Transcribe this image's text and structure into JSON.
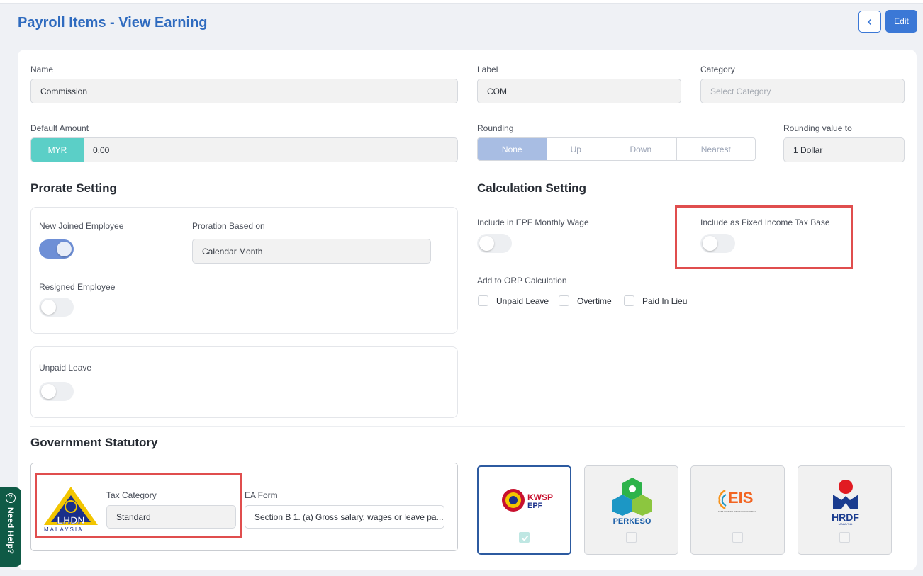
{
  "header": {
    "title": "Payroll Items - View Earning",
    "back_icon": "chevron-left-icon",
    "edit_label": "Edit"
  },
  "form": {
    "name": {
      "label": "Name",
      "value": "Commission"
    },
    "label_field": {
      "label": "Label",
      "value": "COM"
    },
    "category": {
      "label": "Category",
      "placeholder": "Select Category"
    },
    "default_amount": {
      "label": "Default Amount",
      "currency": "MYR",
      "value": "0.00"
    },
    "rounding": {
      "label": "Rounding",
      "options": [
        "None",
        "Up",
        "Down",
        "Nearest"
      ],
      "selected": "None"
    },
    "rounding_value": {
      "label": "Rounding value to",
      "value": "1 Dollar"
    }
  },
  "prorate": {
    "title": "Prorate Setting",
    "new_joined": {
      "label": "New Joined Employee",
      "on": true
    },
    "proration_based": {
      "label": "Proration Based on",
      "value": "Calendar Month"
    },
    "resigned": {
      "label": "Resigned Employee",
      "on": false
    },
    "unpaid_leave": {
      "label": "Unpaid Leave",
      "on": false
    }
  },
  "calculation": {
    "title": "Calculation Setting",
    "epf_monthly_wage": {
      "label": "Include in EPF Monthly Wage",
      "on": false
    },
    "fixed_income_tax": {
      "label": "Include as Fixed Income Tax Base",
      "on": false
    },
    "orp": {
      "label": "Add to ORP Calculation",
      "options": [
        "Unpaid Leave",
        "Overtime",
        "Paid In Lieu"
      ]
    }
  },
  "statutory": {
    "title": "Government Statutory",
    "lhdn": {
      "logo_text": "LHDN",
      "logo_sub": "MALAYSIA"
    },
    "tax_category": {
      "label": "Tax Category",
      "value": "Standard"
    },
    "ea_form": {
      "label": "EA Form",
      "value": "Section B 1. (a) Gross salary, wages or leave pa..."
    },
    "cards": [
      {
        "name": "KWSP EPF",
        "line1": "KWSP",
        "line2": "EPF",
        "checked": true
      },
      {
        "name": "PERKESO",
        "line1": "PERKESO",
        "checked": false
      },
      {
        "name": "EIS",
        "line1": "EIS",
        "line2": "EMPLOYMENT INSURANCE SYSTEM",
        "checked": false
      },
      {
        "name": "HRDF",
        "line1": "HRDF",
        "line2": "MALAYSIA",
        "checked": false
      }
    ]
  },
  "help": {
    "label": "Need Help?"
  },
  "colors": {
    "accent": "#3b78d6",
    "title": "#2f6bbf",
    "currency_badge": "#5bcfc7",
    "highlight": "#e04e4e"
  }
}
